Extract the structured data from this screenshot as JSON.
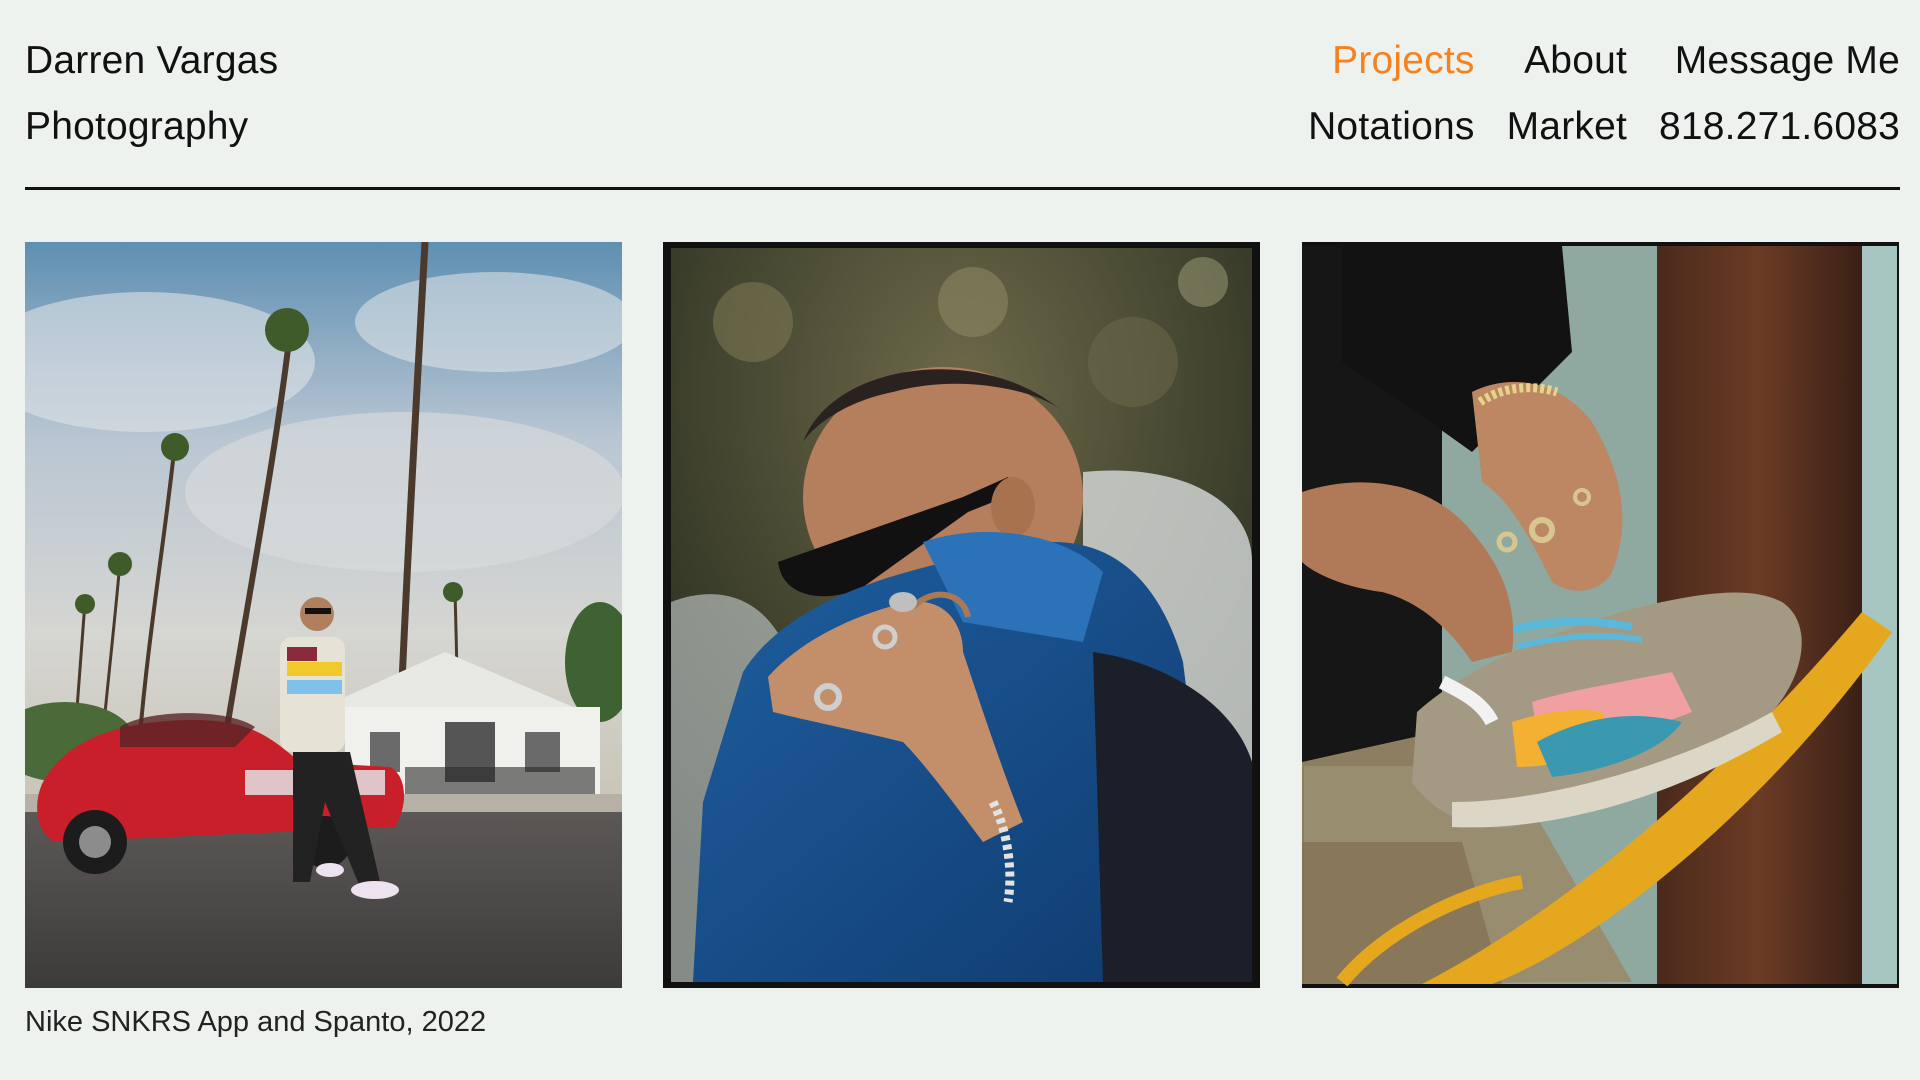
{
  "header": {
    "brand_line1": "Darren Vargas",
    "brand_line2": "Photography",
    "nav": {
      "projects": "Projects",
      "about": "About",
      "message": "Message Me",
      "notations": "Notations",
      "market": "Market",
      "phone": "818.271.6083"
    },
    "active_color": "#f5821f"
  },
  "gallery": {
    "caption": "Nike SNKRS App and Spanto, 2022"
  }
}
